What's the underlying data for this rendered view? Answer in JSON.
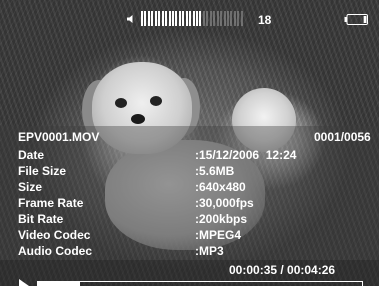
{
  "status": {
    "volume_level": 18,
    "volume_total_bars": 30,
    "volume_filled_bars": 18,
    "battery_fraction": 0.15
  },
  "file": {
    "name": "EPV0001.MOV",
    "counter": "0001/0056"
  },
  "details": [
    {
      "label": "Date",
      "value": ":15/12/2006  12:24"
    },
    {
      "label": "File Size",
      "value": ":5.6MB"
    },
    {
      "label": "Size",
      "value": ":640x480"
    },
    {
      "label": "Frame Rate",
      "value": ":30,000fps"
    },
    {
      "label": "Bit Rate",
      "value": ":200kbps"
    },
    {
      "label": "Video Codec",
      "value": ":MPEG4"
    },
    {
      "label": "Audio Codec",
      "value": ":MP3"
    }
  ],
  "playback": {
    "time": "00:00:35 / 00:04:26",
    "progress_fraction": 0.13
  },
  "icons": {
    "volume": "speaker-icon",
    "battery": "battery-icon",
    "play": "play-icon"
  }
}
